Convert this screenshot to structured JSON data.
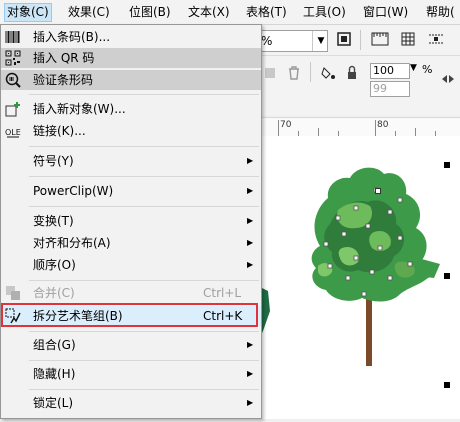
{
  "menubar": {
    "items": [
      {
        "label": "对象(C)"
      },
      {
        "label": "效果(C)"
      },
      {
        "label": "位图(B)"
      },
      {
        "label": "文本(X)"
      },
      {
        "label": "表格(T)"
      },
      {
        "label": "工具(O)"
      },
      {
        "label": "窗口(W)"
      },
      {
        "label": "帮助("
      }
    ]
  },
  "toolbar": {
    "zoom_value": "%",
    "size_top": "100",
    "size_bottom": "99",
    "percent_label": "%"
  },
  "ruler": {
    "mark": "70",
    "mark2": "80"
  },
  "menu": {
    "items": [
      {
        "label": "插入条码(B)...",
        "icon": "barcode-icon"
      },
      {
        "label": "插入 QR 码",
        "icon": "qr-code-icon"
      },
      {
        "label": "验证条形码",
        "icon": "verify-barcode-icon"
      },
      {
        "label": "插入新对象(W)...",
        "icon": "insert-object-icon"
      },
      {
        "label": "链接(K)...",
        "icon": "ole-icon"
      },
      {
        "label": "符号(Y)"
      },
      {
        "label": "PowerClip(W)"
      },
      {
        "label": "变换(T)"
      },
      {
        "label": "对齐和分布(A)"
      },
      {
        "label": "顺序(O)"
      },
      {
        "label": "合并(C)",
        "shortcut": "Ctrl+L",
        "icon": "combine-icon"
      },
      {
        "label": "拆分艺术笔组(B)",
        "shortcut": "Ctrl+K",
        "icon": "break-apart-icon"
      },
      {
        "label": "组合(G)"
      },
      {
        "label": "隐藏(H)"
      },
      {
        "label": "锁定(L)"
      }
    ]
  },
  "colors": {
    "highlight": "#cfcfcf",
    "selected": "#dbeefc",
    "red_outline": "#e0333a"
  }
}
